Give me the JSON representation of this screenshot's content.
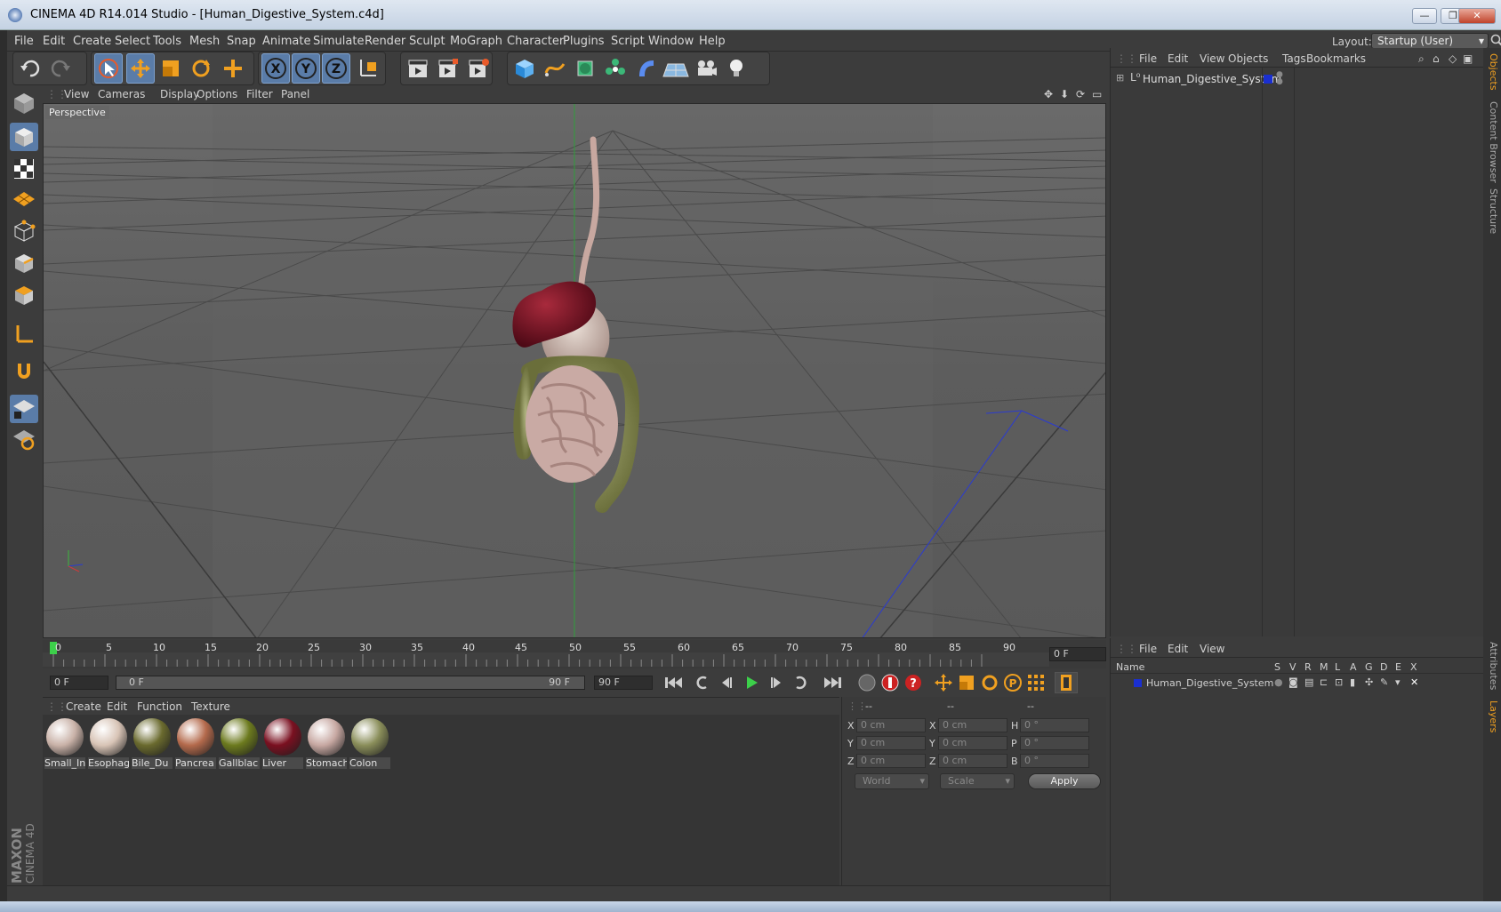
{
  "window": {
    "title": "CINEMA 4D R14.014 Studio - [Human_Digestive_System.c4d]"
  },
  "menubar": {
    "items": [
      "File",
      "Edit",
      "Create",
      "Select",
      "Tools",
      "Mesh",
      "Snap",
      "Animate",
      "Simulate",
      "Render",
      "Sculpt",
      "MoGraph",
      "Character",
      "Plugins",
      "Script",
      "Window",
      "Help"
    ],
    "layout_label": "Layout:",
    "layout_value": "Startup (User)"
  },
  "viewport": {
    "menu": [
      "View",
      "Cameras",
      "Display",
      "Options",
      "Filter",
      "Panel"
    ],
    "label": "Perspective"
  },
  "timeline": {
    "ticks": [
      "0",
      "5",
      "10",
      "15",
      "20",
      "25",
      "30",
      "35",
      "40",
      "45",
      "50",
      "55",
      "60",
      "65",
      "70",
      "75",
      "80",
      "85",
      "90"
    ],
    "current_frame": "0 F",
    "start_field": "0 F",
    "range_start": "0 F",
    "range_end": "90 F",
    "end_field": "90 F"
  },
  "materials": {
    "menu": [
      "Create",
      "Edit",
      "Function",
      "Texture"
    ],
    "items": [
      {
        "name": "Small_In",
        "color": "#c9b2a8"
      },
      {
        "name": "Esophag",
        "color": "#d8c4b6"
      },
      {
        "name": "Bile_Du",
        "color": "#6a6a2e"
      },
      {
        "name": "Pancrea",
        "color": "#b46a4c"
      },
      {
        "name": "Gallblac",
        "color": "#6c7a1e"
      },
      {
        "name": "Liver",
        "color": "#7a1020"
      },
      {
        "name": "Stomach",
        "color": "#c7a8a2"
      },
      {
        "name": "Colon",
        "color": "#8a8e5a"
      }
    ]
  },
  "coords": {
    "headers": [
      "--",
      "--",
      "--"
    ],
    "rows": [
      {
        "a": "X",
        "av": "0 cm",
        "b": "X",
        "bv": "0 cm",
        "c": "H",
        "cv": "0 °"
      },
      {
        "a": "Y",
        "av": "0 cm",
        "b": "Y",
        "bv": "0 cm",
        "c": "P",
        "cv": "0 °"
      },
      {
        "a": "Z",
        "av": "0 cm",
        "b": "Z",
        "bv": "0 cm",
        "c": "B",
        "cv": "0 °"
      }
    ],
    "world": "World",
    "scale": "Scale",
    "apply": "Apply"
  },
  "objects": {
    "menu": [
      "File",
      "Edit",
      "View",
      "Objects",
      "Tags",
      "Bookmarks"
    ],
    "root": "Human_Digestive_System"
  },
  "layers": {
    "menu": [
      "File",
      "Edit",
      "View"
    ],
    "col_name": "Name",
    "cols": [
      "S",
      "V",
      "R",
      "M",
      "L",
      "A",
      "G",
      "D",
      "E",
      "X"
    ],
    "row": "Human_Digestive_System"
  },
  "sidetabs": [
    "Objects",
    "Content Browser",
    "Structure",
    "Attributes",
    "Layers"
  ],
  "brand": {
    "line1": "MAXON",
    "line2": "CINEMA 4D"
  },
  "colors": {
    "accent": "#5a7ca8",
    "layer_blue": "#1a2fd0"
  }
}
